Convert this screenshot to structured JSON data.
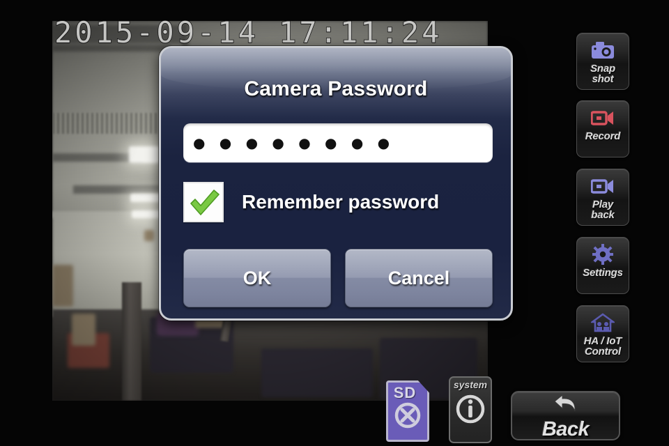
{
  "video": {
    "timestamp": "2015-09-14 17:11:24",
    "scene_description": "indoor ceiling with fluorescent lights"
  },
  "dialog": {
    "title": "Camera Password",
    "password": {
      "name": "password-input",
      "masked_value": "● ● ● ● ● ● ● ●",
      "placeholder": "",
      "char_count": 8
    },
    "remember": {
      "label": "Remember password",
      "checked": true,
      "check_icon": "check-icon"
    },
    "buttons": {
      "ok": "OK",
      "cancel": "Cancel"
    }
  },
  "sidebar": {
    "items": [
      {
        "label": "Snap\nshot",
        "icon": "camera-icon",
        "icon_color": "#8b8bdc"
      },
      {
        "label": "Record",
        "icon": "camcorder-icon",
        "icon_color": "#d9535e"
      },
      {
        "label": "Play\nback",
        "icon": "camcorder-icon",
        "icon_color": "#8b8bdc"
      },
      {
        "label": "Settings",
        "icon": "gear-icon",
        "icon_color": "#6f6fc4"
      },
      {
        "label": "HA / IoT\nControl",
        "icon": "home-iot-icon",
        "icon_color": "#5b5bb0"
      }
    ]
  },
  "status_icons": {
    "sd": {
      "label": "SD",
      "state_icon": "x-circle-icon",
      "color": "#6a5cb8"
    },
    "system": {
      "label": "system",
      "state_icon": "info-circle-icon"
    }
  },
  "back": {
    "label": "Back",
    "icon": "back-arrow-icon"
  },
  "colors": {
    "dialog_bg_top": "#8b93a8",
    "dialog_bg_bottom": "#1a2240",
    "dialog_border": "#c9ccd2",
    "button_face": "#a2a8bb",
    "check_green": "#7ac943",
    "sd_purple": "#6a5cb8",
    "accent_text": "#ffffff"
  }
}
